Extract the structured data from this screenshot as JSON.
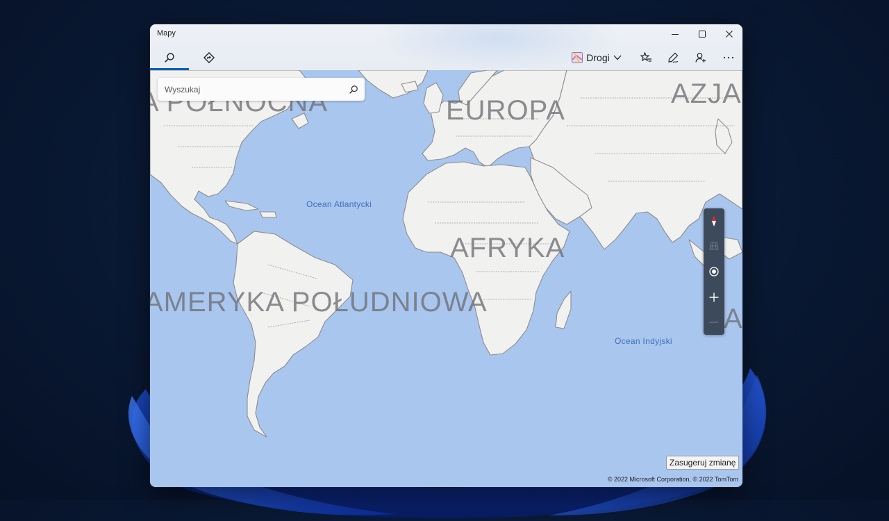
{
  "window": {
    "title": "Mapy"
  },
  "nav": {
    "tabs": [
      {
        "name": "search",
        "icon": "search-icon",
        "active": true
      },
      {
        "name": "directions",
        "icon": "directions-icon",
        "active": false
      }
    ]
  },
  "toolbar": {
    "map_style_label": "Drogi",
    "icons": [
      "map-style-icon",
      "chevron-down-icon",
      "favorites-icon",
      "ink-pen-icon",
      "account-icon",
      "more-icon"
    ]
  },
  "search": {
    "placeholder": "Wyszukaj"
  },
  "map": {
    "continent_labels": {
      "north_america": "A PÓŁNOCNA",
      "europe": "EUROPA",
      "asia": "AZJA",
      "africa": "AFRYKA",
      "south_america": "AMERYKA POŁUDNIOWA",
      "australia_fragment": "A"
    },
    "ocean_labels": {
      "atlantic": "Ocean Atlantycki",
      "indian": "Ocean Indyjski"
    },
    "controls": [
      "compass-icon",
      "tilt-icon",
      "locate-icon",
      "zoom-in-icon",
      "zoom-out-icon"
    ]
  },
  "footer": {
    "suggest_change_label": "Zasugeruj zmianę",
    "copyright": "© 2022 Microsoft Corporation, © 2022 TomTom"
  },
  "colors": {
    "water": "#a9c6ef",
    "land": "#f1f1f0",
    "accent": "#005fb8",
    "controls_bg": "#3d4a5c"
  }
}
